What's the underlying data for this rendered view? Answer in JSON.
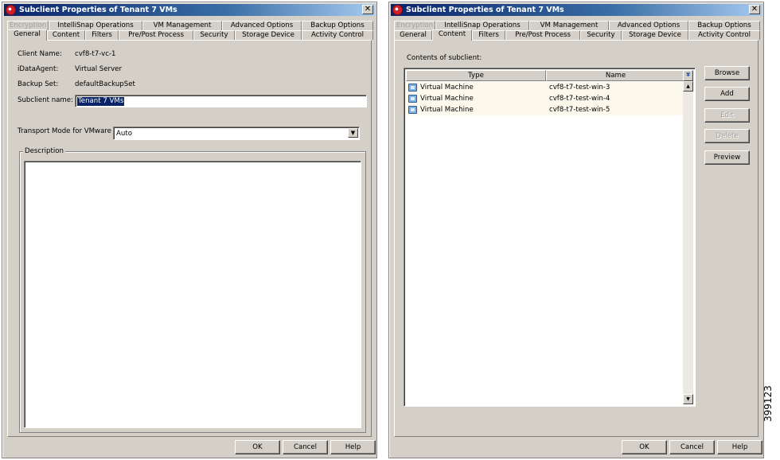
{
  "window_left": {
    "title": "Subclient Properties of Tenant 7 VMs",
    "tabs_row1": [
      "Encryption",
      "IntelliSnap Operations",
      "VM Management",
      "Advanced Options",
      "Backup Options"
    ],
    "tabs_row2": [
      "General",
      "Content",
      "Filters",
      "Pre/Post Process",
      "Security",
      "Storage Device",
      "Activity Control"
    ],
    "active_tab": "General",
    "client_name_label": "Client Name:",
    "client_name_value": "cvf8-t7-vc-1",
    "idataagent_label": "iDataAgent:",
    "idataagent_value": "Virtual Server",
    "backup_set_label": "Backup Set:",
    "backup_set_value": "defaultBackupSet",
    "subclient_name_label": "Subclient name:",
    "subclient_name_value": "Tenant 7 VMs",
    "transport_label": "Transport Mode for VMware",
    "transport_value": "Auto",
    "description_label": "Description",
    "buttons": {
      "ok": "OK",
      "cancel": "Cancel",
      "help": "Help"
    }
  },
  "window_right": {
    "title": "Subclient Properties of Tenant 7 VMs",
    "tabs_row1": [
      "Encryption",
      "IntelliSnap Operations",
      "VM Management",
      "Advanced Options",
      "Backup Options"
    ],
    "tabs_row2": [
      "General",
      "Content",
      "Filters",
      "Pre/Post Process",
      "Security",
      "Storage Device",
      "Activity Control"
    ],
    "active_tab": "Content",
    "contents_label": "Contents of subclient:",
    "columns": [
      "Type",
      "Name"
    ],
    "rows": [
      {
        "type": "Virtual Machine",
        "name": "cvf8-t7-test-win-3"
      },
      {
        "type": "Virtual Machine",
        "name": "cvf8-t7-test-win-4"
      },
      {
        "type": "Virtual Machine",
        "name": "cvf8-t7-test-win-5"
      }
    ],
    "side_buttons": {
      "browse": "Browse",
      "add": "Add",
      "edit": "Edit",
      "delete": "Delete",
      "preview": "Preview"
    },
    "buttons": {
      "ok": "OK",
      "cancel": "Cancel",
      "help": "Help"
    }
  },
  "figure_number": "399123"
}
